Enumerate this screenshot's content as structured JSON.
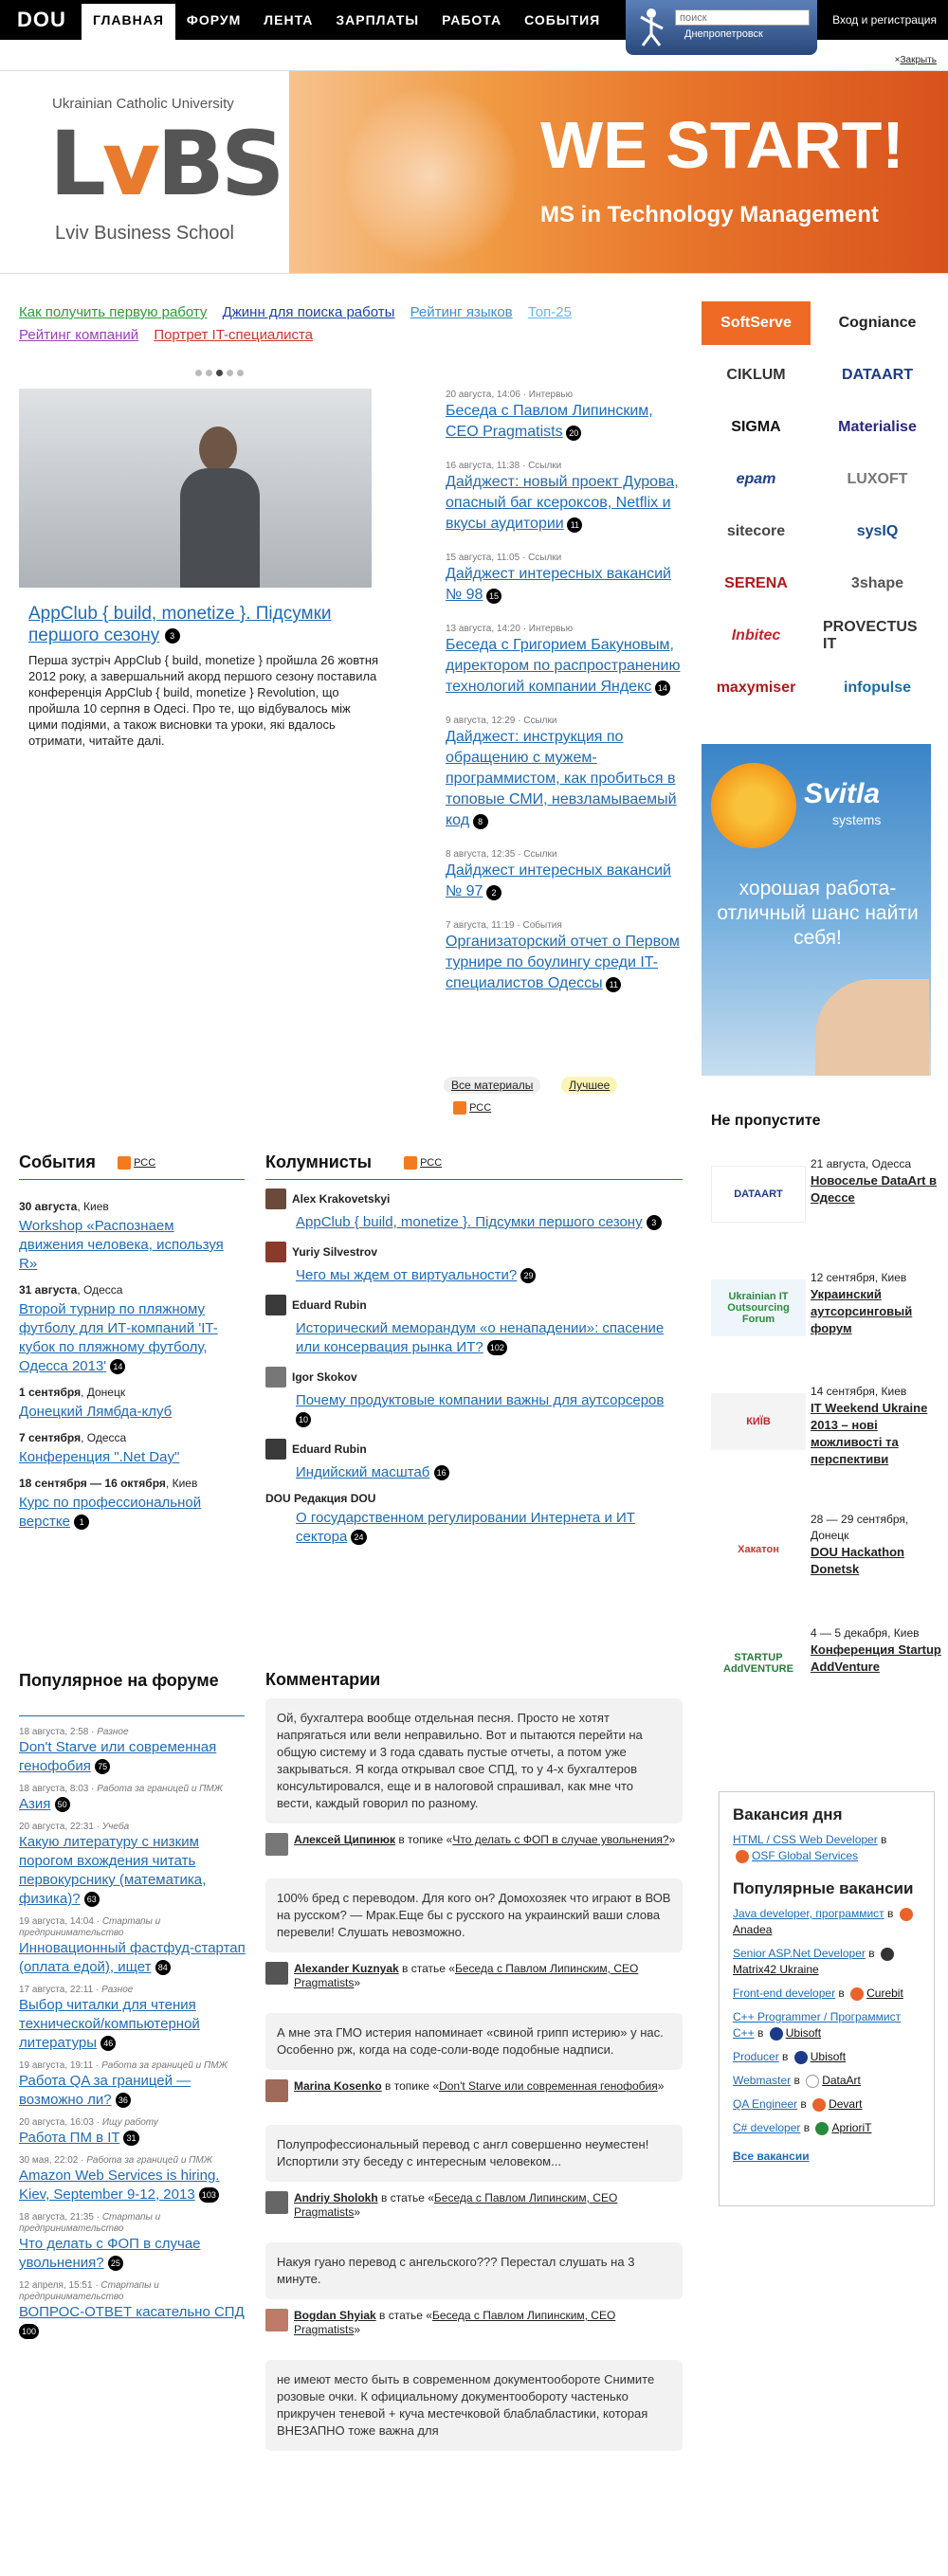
{
  "header": {
    "logo": "DOU",
    "nav": [
      "Главная",
      "Форум",
      "Лента",
      "Зарплаты",
      "Работа",
      "События"
    ],
    "search_placeholder": "поиск",
    "city": "Днепропетровск",
    "login": "Вход и регистрация",
    "close": "Закрыть"
  },
  "banner": {
    "university": "Ukrainian Catholic University",
    "logo_l": "L",
    "logo_v": "v",
    "logo_rest": "BS",
    "school": "Lviv Business School",
    "headline": "WE START!",
    "sub": "MS in Technology Management"
  },
  "quick_links": [
    "Как получить первую работу",
    "Джинн для поиска работы",
    "Рейтинг языков",
    "Топ-25",
    "Рейтинг компаний",
    "Портрет IT-специалиста"
  ],
  "featured": {
    "title": "AppClub { build, monetize }. Підсумки першого сезону",
    "comments": "3",
    "text": "Перша зустріч AppClub { build, monetize } пройшла 26 жовтня 2012 року, а завершальний акорд першого сезону поставила конференція AppClub { build, monetize } Revolution, що пройшла 10 серпня в Одесі. Про те, що відбувалось між цими подіями, а також висновки та уроки, які вдалось отримати, читайте далі."
  },
  "news": [
    {
      "meta": "20 августа, 14:06 · Интервью",
      "title": "Беседа с Павлом Липинским, CEO Pragmatists",
      "count": "20"
    },
    {
      "meta": "16 августа, 11:38 · Ссылки",
      "title": "Дайджест: новый проект Дурова, опасный баг ксероксов, Netflix и вкусы аудитории",
      "count": "11"
    },
    {
      "meta": "15 августа, 11:05 · Ссылки",
      "title": "Дайджест интересных вакансий № 98",
      "count": "15"
    },
    {
      "meta": "13 августа, 14:20 · Интервью",
      "title": "Беседа с Григорием Бакуновым, директором по распространению технологий компании Яндекс",
      "count": "14"
    },
    {
      "meta": "9 августа, 12:29 · Ссылки",
      "title": "Дайджест: инструкция по обращению с мужем-программистом, как пробиться в топовые СМИ, невзламываемый код",
      "count": "8"
    },
    {
      "meta": "8 августа, 12:35 · Ссылки",
      "title": "Дайджест интересных вакансий № 97",
      "count": "2"
    },
    {
      "meta": "7 августа, 11:19 · События",
      "title": "Организаторский отчет о Первом турнире по боулингу среди IT-специалистов Одессы",
      "count": "11"
    }
  ],
  "news_links": {
    "all": "Все материалы",
    "best": "Лучшее",
    "rss": "РСС"
  },
  "partners": [
    "SoftServe",
    "Cogniance",
    "CIKLUM",
    "DATAART",
    "SIGMA",
    "Materialise",
    "epam",
    "LUXOFT",
    "sitecore",
    "sysIQ",
    "SERENA",
    "3shape",
    "Inbitec",
    "PROVECTUS IT",
    "maxymiser",
    "infopulse"
  ],
  "svitla": {
    "name": "Svitla",
    "sub": "systems",
    "text": "хорошая работа-отличный шанс найти себя!"
  },
  "events": {
    "heading": "События",
    "rss": "РСС",
    "items": [
      {
        "date": "30 августа",
        "city": ", Киев",
        "title": "Workshop «Распознаем движения человека, используя R»",
        "count": ""
      },
      {
        "date": "31 августа",
        "city": ", Одесса",
        "title": "Второй турнир по пляжному футболу для ИТ-компаний 'IT-кубок по пляжному футболу, Одесса 2013'",
        "count": "14"
      },
      {
        "date": "1 сентября",
        "city": ", Донецк",
        "title": "Донецкий Лямбда-клуб",
        "count": ""
      },
      {
        "date": "7 сентября",
        "city": ", Одесса",
        "title": "Конференция \".Net Day\"",
        "count": ""
      },
      {
        "date": "18 сентября — 16 октября",
        "city": ", Киев",
        "title": "Курс по профессиональной верстке",
        "count": "1"
      }
    ]
  },
  "columnists": {
    "heading": "Колумнисты",
    "rss": "РСС",
    "items": [
      {
        "author": "Alex Krakovetskyi",
        "title": "AppClub { build, monetize }. Підсумки першого сезону",
        "count": "3"
      },
      {
        "author": "Yuriy Silvestrov",
        "title": "Чего мы ждем от виртуальности?",
        "count": "29"
      },
      {
        "author": "Eduard Rubin",
        "title": "Исторический меморандум «о ненападении»: спасение или консервация рынка ИТ?",
        "count": "102"
      },
      {
        "author": "Igor Skokov",
        "title": "Почему продуктовые компании важны для аутсорсеров",
        "count": "10"
      },
      {
        "author": "Eduard Rubin",
        "title": "Индийский масштаб",
        "count": "16"
      },
      {
        "author": "DOU Редакция DOU",
        "title": "О государственном регулировании Интернета и ИТ сектора",
        "count": "24"
      }
    ]
  },
  "dont_miss": {
    "heading": "Не пропустите",
    "items": [
      {
        "img": "DATAART",
        "date": "21 августа, Одесса",
        "title": "Новоселье DataArt в Одессе"
      },
      {
        "img": "Ukrainian IT Outsourcing Forum",
        "date": "12 сентября, Киев",
        "title": "Украинский аутсорсинговый форум"
      },
      {
        "img": "КИЇВ",
        "date": "14 сентября, Киев",
        "title": "IT Weekend Ukraine 2013 – нові можливості та перспективи"
      },
      {
        "img": "Хакатон",
        "date": "28 — 29 сентября, Донецк",
        "title": "DOU Hackathon Donetsk"
      },
      {
        "img": "STARTUP AddVENTURE",
        "date": "4 — 5 декабря, Киев",
        "title": "Конференция Startup AddVenture"
      }
    ]
  },
  "forum": {
    "heading": "Популярное на форуме",
    "items": [
      {
        "meta": "18 августа, 2:58 · ",
        "cat": "Разное",
        "title": "Don't Starve или современная генофобия",
        "count": "75"
      },
      {
        "meta": "18 августа, 8:03 · ",
        "cat": "Работа за границей и ПМЖ",
        "title": "Азия",
        "count": "50"
      },
      {
        "meta": "20 августа, 22:31 · ",
        "cat": "Учеба",
        "title": "Какую литературу с низким порогом вхождения читать первокурснику (математика, физика)?",
        "count": "63"
      },
      {
        "meta": "19 августа, 14:04 · ",
        "cat": "Стартапы и предпринимательство",
        "title": "Инновационный фастфуд-стартап (оплата едой), ищет",
        "count": "84"
      },
      {
        "meta": "17 августа, 22:11 · ",
        "cat": "Разное",
        "title": "Выбор читалки для чтения технической/компьютерной литературы",
        "count": "46"
      },
      {
        "meta": "19 августа, 19:11 · ",
        "cat": "Работа за границей и ПМЖ",
        "title": "Работа QA за границей — возможно ли?",
        "count": "36"
      },
      {
        "meta": "20 августа, 16:03 · ",
        "cat": "Ищу работу",
        "title": "Работа ПМ в IT",
        "count": "31"
      },
      {
        "meta": "30 мая, 22:02 · ",
        "cat": "Работа за границей и ПМЖ",
        "title": "Amazon Web Services is hiring. Kiev, September 9-12, 2013",
        "count": "103"
      },
      {
        "meta": "18 августа, 21:35 · ",
        "cat": "Стартапы и предпринимательство",
        "title": "Что делать с ФОП в случае увольнения?",
        "count": "25"
      },
      {
        "meta": "12 апреля, 15:51 · ",
        "cat": "Стартапы и предпринимательство",
        "title": "ВОПРОС-ОТВЕТ касательно СПД",
        "count": "100"
      }
    ]
  },
  "comments": {
    "heading": "Комментарии",
    "items": [
      {
        "text": "Ой, бухгалтера вообще отдельная песня. Просто не хотят напрягаться или вели неправильно. Вот и пытаются перейти на общую систему и 3 года сдавать пустые отчеты, а потом уже закрываться. Я когда открывал свое СПД, то у 4-х бухгалтеров консультировался, еще и в налоговой спрашивал, как мне что вести, каждый говорил по разному.",
        "author": "Алексей Ципинюк",
        "where": " в топике «",
        "topic": "Что делать с ФОП в случае увольнения?",
        "end": "»"
      },
      {
        "text": "100% бред с переводом. Для кого он? Домохозяек что играют в ВОВ на русском? — Мрак.Еще бы с русского на украинский ваши слова перевели! Слушать невозможно.",
        "author": "Alexander Kuznyak",
        "where": " в статье «",
        "topic": "Беседа с Павлом Липинским, CEO Pragmatists",
        "end": "»"
      },
      {
        "text": "А мне эта ГМО истерия напоминает «свиной грипп истерию» у нас. Особенно рж, когда на соде-соли-воде подобные надписи.",
        "author": "Marina Kosenko",
        "where": " в топике «",
        "topic": "Don't Starve или современная генофобия",
        "end": "»"
      },
      {
        "text": "Полупрофессиональный перевод с англ совершенно неуместен! Испортили эту беседу с интересным человеком...",
        "author": "Andriy Sholokh",
        "where": " в статье «",
        "topic": "Беседа с Павлом Липинским, CEO Pragmatists",
        "end": "»"
      },
      {
        "text": "Накуя гуано перевод с ангельского??? Перестал слушать на 3 минуте.",
        "author": "Bogdan Shyiak",
        "where": " в статье «",
        "topic": "Беседа с Павлом Липинским, CEO Pragmatists",
        "end": "»"
      },
      {
        "text": "не имеют место быть в современном документообороте Снимите розовые очки. К официальному документообороту частенько прикручен теневой + куча местечковой блаблабластики, которая ВНЕЗАПНО тоже важна для",
        "author": "",
        "where": "",
        "topic": "",
        "end": ""
      }
    ]
  },
  "jobs": {
    "day_heading": "Вакансия дня",
    "day_title": "HTML / CSS Web Developer",
    "day_in": " в ",
    "day_company": "OSF Global Services",
    "popular_heading": "Популярные вакансии",
    "items": [
      {
        "title": "Java developer, программист",
        "company": "Anadea"
      },
      {
        "title": "Senior ASP.Net Developer",
        "company": "Matrix42 Ukraine"
      },
      {
        "title": "Front-end developer",
        "company": "Curebit"
      },
      {
        "title": "C++ Programmer / Программист C++",
        "company": "Ubisoft"
      },
      {
        "title": "Producer",
        "company": "Ubisoft"
      },
      {
        "title": "Webmaster",
        "company": "DataArt"
      },
      {
        "title": "QA Engineer",
        "company": "Devart"
      },
      {
        "title": "C# developer",
        "company": "AprioriT"
      }
    ],
    "all": "Все вакансии",
    "in": " в "
  }
}
